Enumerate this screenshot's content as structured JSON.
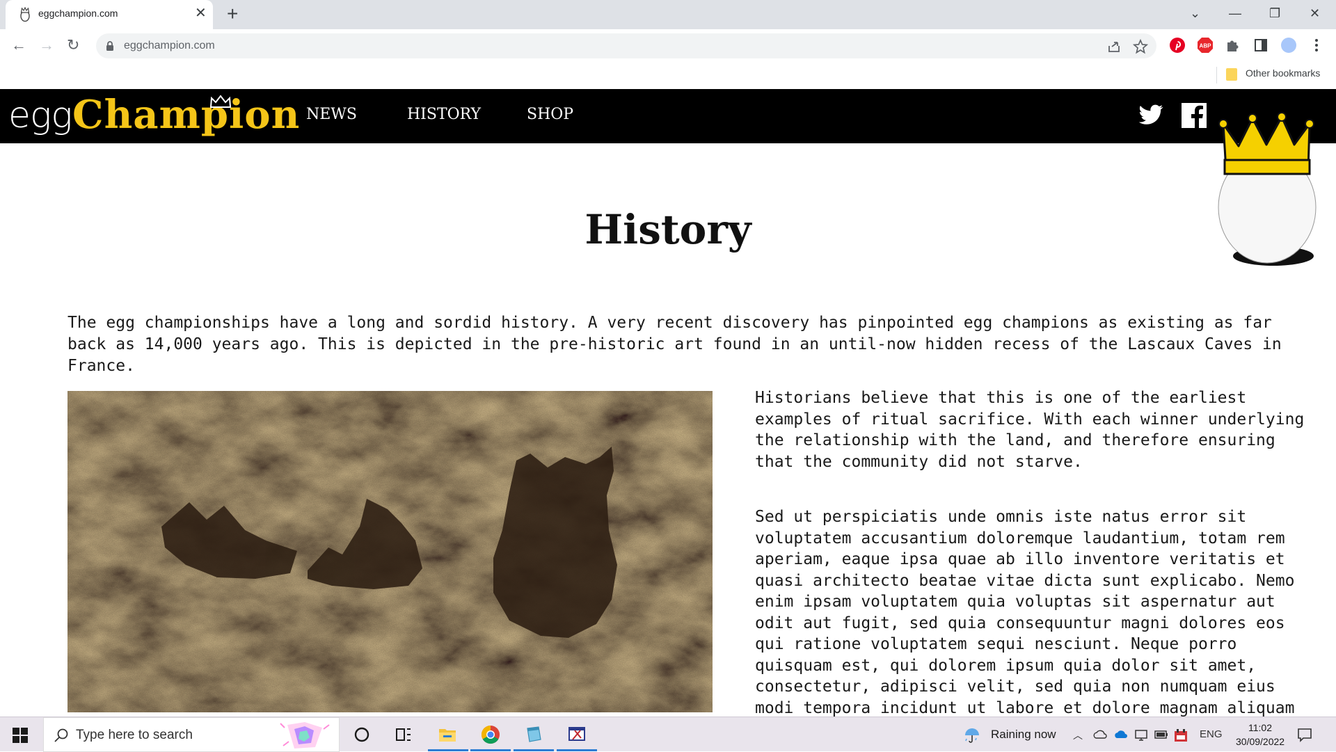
{
  "browser": {
    "tab_title": "eggchampion.com",
    "tab_close": "✕",
    "new_tab": "+",
    "window_controls": {
      "tablist": "⌄",
      "minimize": "—",
      "restore": "❐",
      "close": "✕"
    },
    "nav": {
      "back": "←",
      "forward": "→",
      "reload": "↻"
    },
    "url": "eggchampion.com",
    "bookmarks_label": "Other bookmarks",
    "extension_icons": [
      "share-icon",
      "star-icon",
      "pinterest-icon",
      "adblock-icon",
      "puzzle-extensions-icon",
      "sidepanel-icon",
      "profile-avatar",
      "kebab-menu-icon"
    ],
    "adblock_label": "ABP"
  },
  "site": {
    "logo_egg": "egg",
    "logo_champion": "Champion",
    "nav": [
      "NEWS",
      "HISTORY",
      "SHOP"
    ],
    "social": [
      "twitter-icon",
      "facebook-icon"
    ],
    "brand_color": "#f5c518"
  },
  "content": {
    "title": "History",
    "intro": "The egg championships have a long and sordid history. A very recent discovery has pinpointed egg champions as existing as far back as 14,000 years ago. This is depicted in the pre-historic art found in an until-now hidden recess of the Lascaux Caves in France.",
    "para1": "Historians believe that this is one of the earliest examples of ritual sacrifice. With each winner underlying the  relationship with the land, and therefore ensuring that the community did not starve.",
    "para2": "Sed ut perspiciatis unde omnis iste natus error sit voluptatem accusantium doloremque laudantium, totam rem aperiam, eaque ipsa quae ab illo inventore veritatis et quasi architecto beatae vitae dicta sunt explicabo. Nemo enim ipsam voluptatem quia voluptas sit aspernatur aut odit aut fugit, sed quia consequuntur magni dolores eos qui ratione voluptatem sequi nesciunt. Neque porro quisquam est, qui dolorem ipsum quia dolor sit amet, consectetur, adipisci velit, sed quia non numquam eius modi tempora incidunt ut labore et dolore magnam aliquam quaerat"
  },
  "taskbar": {
    "search_placeholder": "Type here to search",
    "weather": "Raining now",
    "language": "ENG",
    "time": "11:02",
    "date": "30/09/2022",
    "pinned": [
      "cortana-icon",
      "task-view-icon",
      "file-explorer-icon",
      "chrome-icon",
      "notepad-icon",
      "snipping-tool-icon"
    ]
  }
}
